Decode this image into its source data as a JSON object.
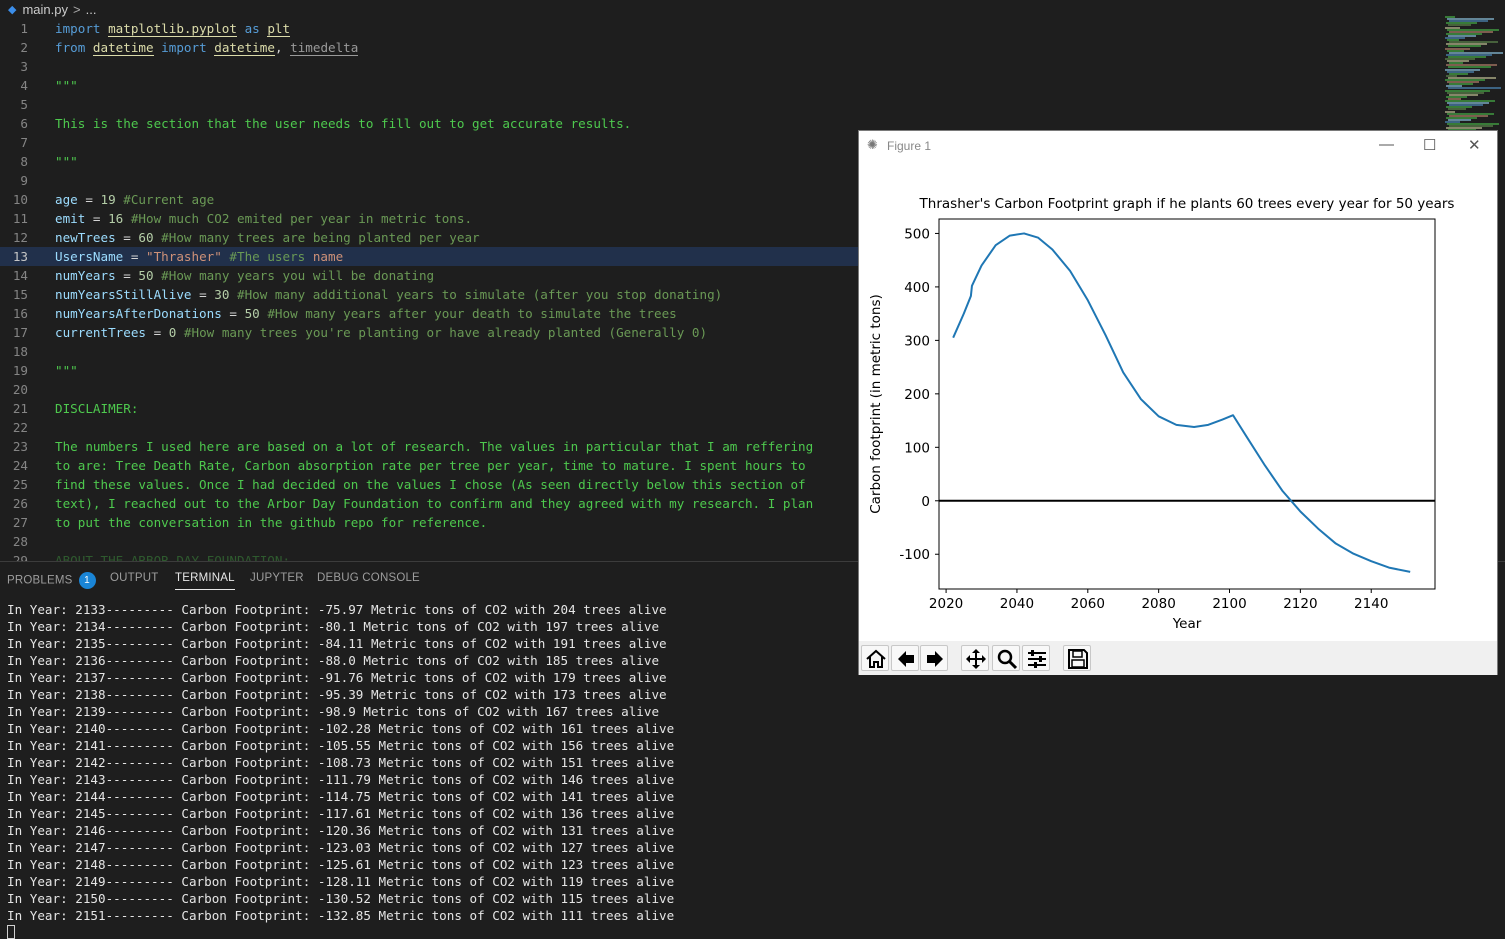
{
  "breadcrumb": {
    "file": "main.py",
    "separator": ">",
    "rest": "..."
  },
  "code_lines": [
    {
      "n": 1,
      "tokens": [
        [
          "kw",
          "import "
        ],
        [
          "mod",
          "matplotlib.pyplot"
        ],
        [
          "kw",
          " as "
        ],
        [
          "mod",
          "plt"
        ]
      ]
    },
    {
      "n": 2,
      "tokens": [
        [
          "kw",
          "from "
        ],
        [
          "mod",
          "datetime"
        ],
        [
          "kw",
          " import "
        ],
        [
          "mod",
          "datetime"
        ],
        [
          "pun",
          ", "
        ],
        [
          "mod2",
          "timedelta"
        ]
      ]
    },
    {
      "n": 3,
      "tokens": []
    },
    {
      "n": 4,
      "tokens": [
        [
          "doc",
          "\"\"\""
        ]
      ]
    },
    {
      "n": 5,
      "tokens": []
    },
    {
      "n": 6,
      "tokens": [
        [
          "doc",
          "This is the section that the user needs to fill out to get accurate results."
        ]
      ]
    },
    {
      "n": 7,
      "tokens": []
    },
    {
      "n": 8,
      "tokens": [
        [
          "doc",
          "\"\"\""
        ]
      ]
    },
    {
      "n": 9,
      "tokens": []
    },
    {
      "n": 10,
      "tokens": [
        [
          "id",
          "age"
        ],
        [
          "op",
          " = "
        ],
        [
          "num",
          "19"
        ],
        [
          "cmt",
          " #Current age"
        ]
      ]
    },
    {
      "n": 11,
      "tokens": [
        [
          "id",
          "emit"
        ],
        [
          "op",
          " = "
        ],
        [
          "num",
          "16"
        ],
        [
          "cmt",
          " #How much CO2 emited per year in metric tons."
        ]
      ]
    },
    {
      "n": 12,
      "tokens": [
        [
          "id",
          "newTrees"
        ],
        [
          "op",
          " = "
        ],
        [
          "num",
          "60"
        ],
        [
          "cmt",
          " #How many trees are being planted per year"
        ]
      ]
    },
    {
      "n": 13,
      "tokens": [
        [
          "id",
          "UsersName"
        ],
        [
          "op",
          " = "
        ],
        [
          "str",
          "\"Thrasher\""
        ],
        [
          "cmt",
          " #The users "
        ],
        [
          "str",
          "name"
        ]
      ]
    },
    {
      "n": 14,
      "tokens": [
        [
          "id",
          "numYears"
        ],
        [
          "op",
          " = "
        ],
        [
          "num",
          "50"
        ],
        [
          "cmt",
          " #How many years you will be donating"
        ]
      ]
    },
    {
      "n": 15,
      "tokens": [
        [
          "id",
          "numYearsStillAlive"
        ],
        [
          "op",
          " = "
        ],
        [
          "num",
          "30"
        ],
        [
          "cmt",
          " #How many additional years to simulate (after you stop donating)"
        ]
      ]
    },
    {
      "n": 16,
      "tokens": [
        [
          "id",
          "numYearsAfterDonations"
        ],
        [
          "op",
          " = "
        ],
        [
          "num",
          "50"
        ],
        [
          "cmt",
          " #How many years after your death to simulate the trees"
        ]
      ]
    },
    {
      "n": 17,
      "tokens": [
        [
          "id",
          "currentTrees"
        ],
        [
          "op",
          " = "
        ],
        [
          "num",
          "0"
        ],
        [
          "cmt",
          " #How many trees you're planting or have already planted (Generally 0)"
        ]
      ]
    },
    {
      "n": 18,
      "tokens": []
    },
    {
      "n": 19,
      "tokens": [
        [
          "doc",
          "\"\"\""
        ]
      ]
    },
    {
      "n": 20,
      "tokens": []
    },
    {
      "n": 21,
      "tokens": [
        [
          "doc",
          "DISCLAIMER:"
        ]
      ]
    },
    {
      "n": 22,
      "tokens": []
    },
    {
      "n": 23,
      "tokens": [
        [
          "doc",
          "The numbers I used here are based on a lot of research. The values in particular that I am reffering"
        ]
      ]
    },
    {
      "n": 24,
      "tokens": [
        [
          "doc",
          "to are: Tree Death Rate, Carbon absorption rate per tree per year, time to mature. I spent hours to"
        ]
      ]
    },
    {
      "n": 25,
      "tokens": [
        [
          "doc",
          "find these values. Once I had decided on the values I chose (As seen directly below this section of"
        ]
      ]
    },
    {
      "n": 26,
      "tokens": [
        [
          "doc",
          "text), I reached out to the Arbor Day Foundation to confirm and they agreed with my research. I plan"
        ]
      ]
    },
    {
      "n": 27,
      "tokens": [
        [
          "doc",
          "to put the conversation in the github repo for reference."
        ]
      ]
    },
    {
      "n": 28,
      "tokens": []
    },
    {
      "n": 29,
      "tokens": [
        [
          "doc",
          "ABOUT THE ARBOR DAY FOUNDATION:"
        ]
      ]
    }
  ],
  "current_line": 13,
  "panel": {
    "tabs": [
      {
        "label": "PROBLEMS",
        "badge": "1"
      },
      {
        "label": "OUTPUT"
      },
      {
        "label": "TERMINAL",
        "active": true
      },
      {
        "label": "JUPYTER"
      },
      {
        "label": "DEBUG CONSOLE"
      }
    ],
    "terminal_lines": [
      "In Year: 2133--------- Carbon Footprint: -75.97 Metric tons of CO2 with 204 trees alive",
      "In Year: 2134--------- Carbon Footprint: -80.1 Metric tons of CO2 with 197 trees alive",
      "In Year: 2135--------- Carbon Footprint: -84.11 Metric tons of CO2 with 191 trees alive",
      "In Year: 2136--------- Carbon Footprint: -88.0 Metric tons of CO2 with 185 trees alive",
      "In Year: 2137--------- Carbon Footprint: -91.76 Metric tons of CO2 with 179 trees alive",
      "In Year: 2138--------- Carbon Footprint: -95.39 Metric tons of CO2 with 173 trees alive",
      "In Year: 2139--------- Carbon Footprint: -98.9 Metric tons of CO2 with 167 trees alive",
      "In Year: 2140--------- Carbon Footprint: -102.28 Metric tons of CO2 with 161 trees alive",
      "In Year: 2141--------- Carbon Footprint: -105.55 Metric tons of CO2 with 156 trees alive",
      "In Year: 2142--------- Carbon Footprint: -108.73 Metric tons of CO2 with 151 trees alive",
      "In Year: 2143--------- Carbon Footprint: -111.79 Metric tons of CO2 with 146 trees alive",
      "In Year: 2144--------- Carbon Footprint: -114.75 Metric tons of CO2 with 141 trees alive",
      "In Year: 2145--------- Carbon Footprint: -117.61 Metric tons of CO2 with 136 trees alive",
      "In Year: 2146--------- Carbon Footprint: -120.36 Metric tons of CO2 with 131 trees alive",
      "In Year: 2147--------- Carbon Footprint: -123.03 Metric tons of CO2 with 127 trees alive",
      "In Year: 2148--------- Carbon Footprint: -125.61 Metric tons of CO2 with 123 trees alive",
      "In Year: 2149--------- Carbon Footprint: -128.11 Metric tons of CO2 with 119 trees alive",
      "In Year: 2150--------- Carbon Footprint: -130.52 Metric tons of CO2 with 115 trees alive",
      "In Year: 2151--------- Carbon Footprint: -132.85 Metric tons of CO2 with 111 trees alive"
    ]
  },
  "figure_window": {
    "title": "Figure 1",
    "toolbar": [
      "home-icon",
      "back-icon",
      "forward-icon",
      "pan-icon",
      "zoom-icon",
      "configure-icon",
      "save-icon"
    ]
  },
  "chart_data": {
    "type": "line",
    "title": "Thrasher's Carbon Footprint graph if he plants 60 trees every year for 50 years",
    "xlabel": "Year",
    "ylabel": "Carbon footprint (in metric tons)",
    "xlim": [
      2018,
      2158
    ],
    "ylim": [
      -165,
      527
    ],
    "xticks": [
      2020,
      2040,
      2060,
      2080,
      2100,
      2120,
      2140
    ],
    "yticks": [
      -100,
      0,
      100,
      200,
      300,
      400,
      500
    ],
    "hline": 0,
    "line_color": "#1f77b4",
    "series": [
      {
        "x": [
          2022,
          2025,
          2027,
          2027.3,
          2030,
          2034,
          2038,
          2042,
          2046,
          2050,
          2055,
          2060,
          2065,
          2070,
          2075,
          2080,
          2085,
          2090,
          2094,
          2098,
          2101,
          2105,
          2110,
          2115,
          2120,
          2125,
          2130,
          2135,
          2140,
          2145,
          2151
        ],
        "y": [
          305,
          350,
          383,
          402,
          440,
          478,
          496,
          500,
          492,
          470,
          430,
          375,
          310,
          240,
          190,
          158,
          142,
          138,
          142,
          152,
          160,
          118,
          66,
          18,
          -20,
          -52,
          -80,
          -99,
          -113,
          -125,
          -133
        ]
      }
    ]
  }
}
